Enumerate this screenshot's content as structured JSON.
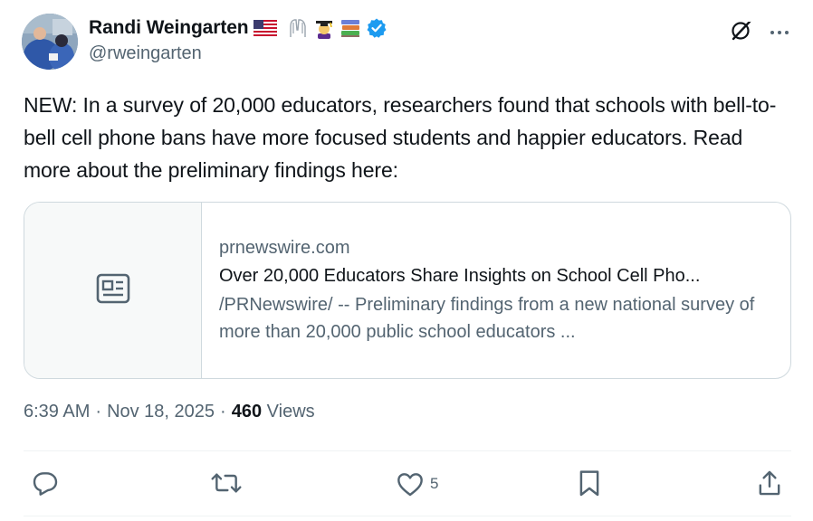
{
  "author": {
    "name": "Randi Weingarten",
    "handle": "@rweingarten",
    "emojis": [
      "us-flag",
      "raised-hands",
      "teacher",
      "books"
    ],
    "verified": true,
    "verified_color": "#1d9bf0"
  },
  "top_actions": {
    "grok_icon": "grok-icon",
    "more_icon": "more-icon"
  },
  "tweet": {
    "text": "NEW: In a survey of 20,000 educators, researchers found that schools with bell-to-bell cell phone bans have more focused students and happier educators. Read more about the preliminary findings here:"
  },
  "link_card": {
    "domain": "prnewswire.com",
    "title": "Over 20,000 Educators Share Insights on School Cell Pho...",
    "description": "/PRNewswire/ -- Preliminary findings from a new national survey of more than 20,000 public school educators ...",
    "thumbnail_icon": "article-icon"
  },
  "meta": {
    "time": "6:39 AM",
    "separator": "·",
    "date": "Nov 18, 2025",
    "views_count": "460",
    "views_label": "Views"
  },
  "actions": {
    "reply_count": "",
    "retweet_count": "",
    "like_count": "5",
    "bookmark_count": "",
    "share_count": ""
  },
  "colors": {
    "text_primary": "#0f1419",
    "text_secondary": "#536471",
    "border": "#cfd9de",
    "accent": "#1d9bf0"
  }
}
